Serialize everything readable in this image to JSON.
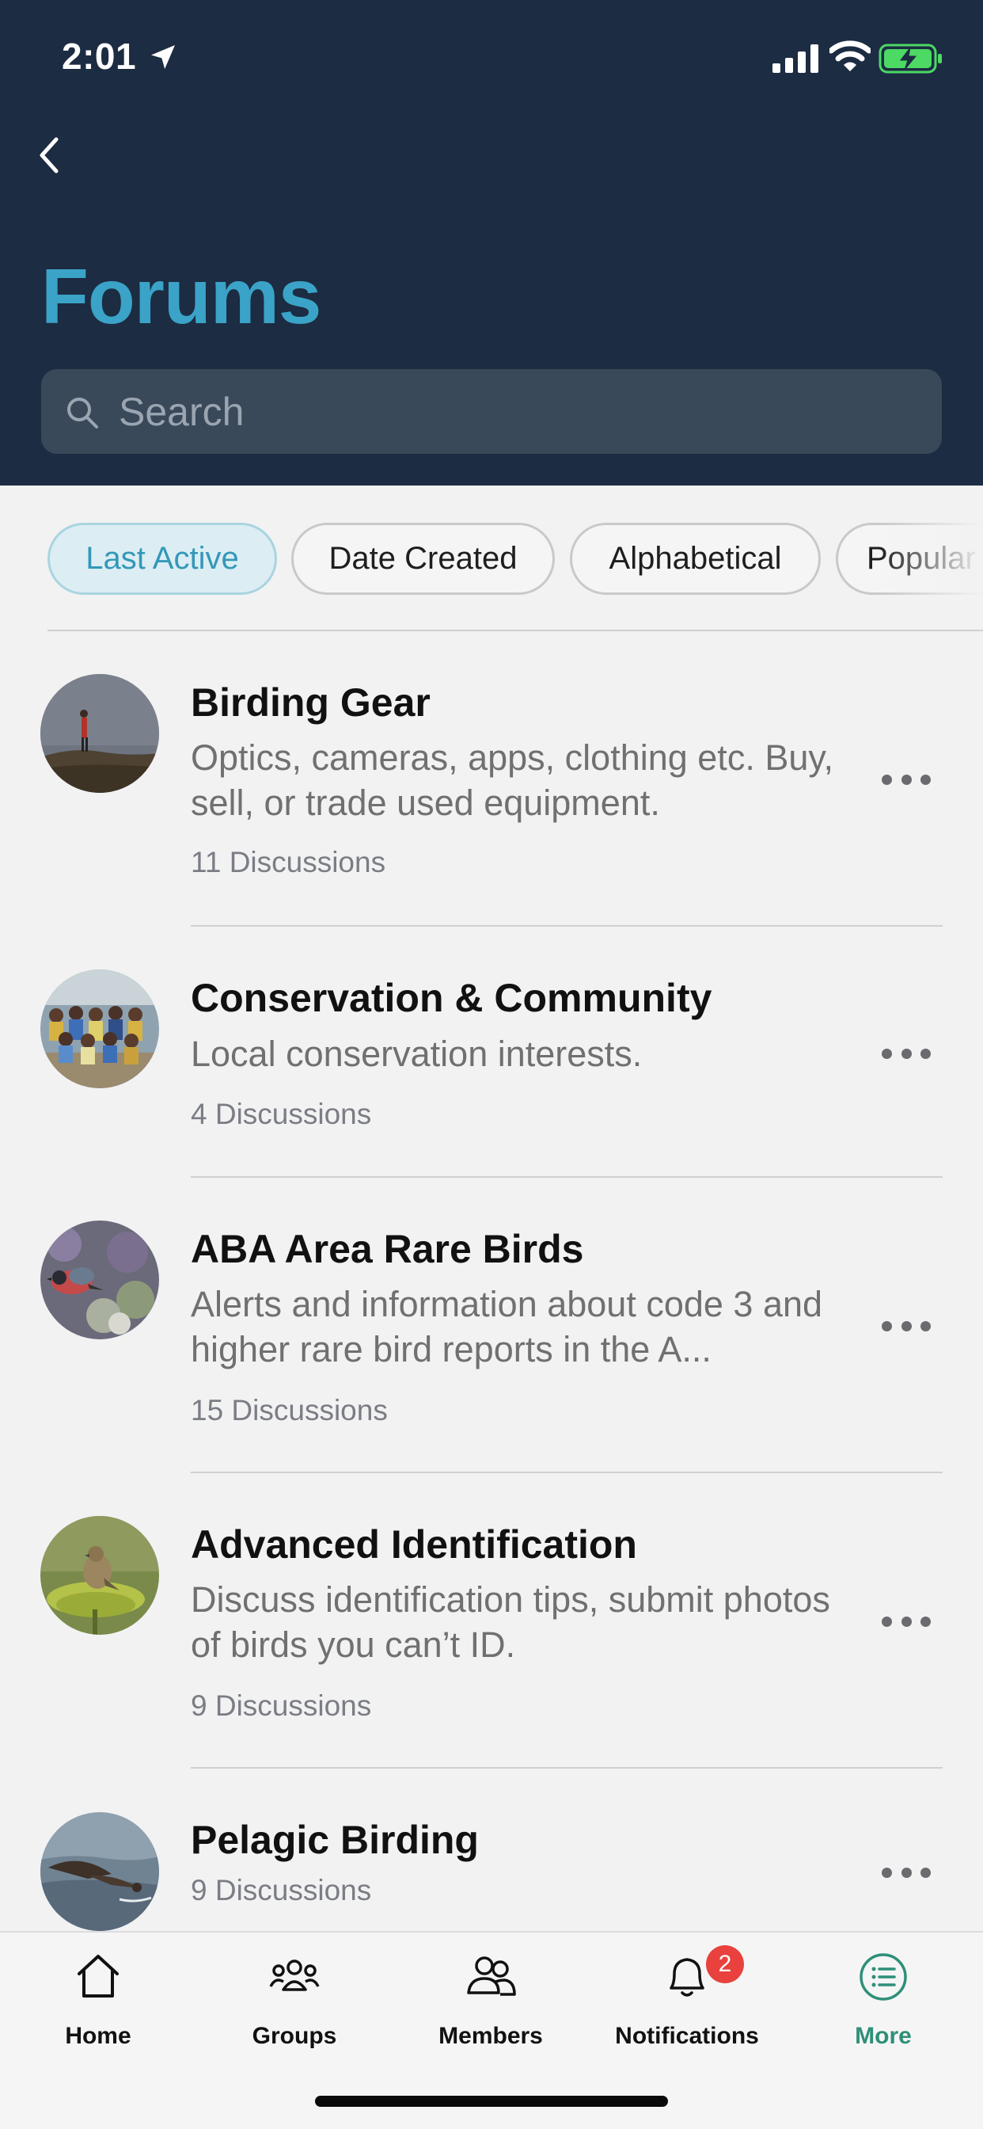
{
  "status_bar": {
    "time": "2:01",
    "icons": [
      "location-arrow-icon",
      "cellular-signal-icon",
      "wifi-icon",
      "battery-charging-icon"
    ]
  },
  "header": {
    "title": "Forums",
    "search_placeholder": "Search",
    "background_color": "#1c2c42",
    "title_color": "#3aa3c7"
  },
  "filters": [
    {
      "label": "Last Active",
      "active": true
    },
    {
      "label": "Date Created",
      "active": false
    },
    {
      "label": "Alphabetical",
      "active": false
    },
    {
      "label": "Popular",
      "active": false
    }
  ],
  "forums": [
    {
      "title": "Birding Gear",
      "description": "Optics, cameras, apps, clothing etc. Buy, sell, or trade used equipment.",
      "count": "11 Discussions"
    },
    {
      "title": "Conservation & Community",
      "description": "Local conservation interests.",
      "count": "4 Discussions"
    },
    {
      "title": "ABA Area Rare Birds",
      "description": "Alerts and information about code 3 and higher rare bird reports in the A...",
      "count": "15 Discussions"
    },
    {
      "title": "Advanced Identification",
      "description": "Discuss identification tips, submit photos of birds you can’t ID.",
      "count": "9 Discussions"
    },
    {
      "title": "Pelagic Birding",
      "description": "",
      "count": "9 Discussions"
    }
  ],
  "tabbar": {
    "items": [
      {
        "label": "Home",
        "icon": "home-icon"
      },
      {
        "label": "Groups",
        "icon": "groups-icon"
      },
      {
        "label": "Members",
        "icon": "members-icon"
      },
      {
        "label": "Notifications",
        "icon": "bell-icon",
        "badge": "2"
      },
      {
        "label": "More",
        "icon": "more-list-icon",
        "active": true
      }
    ],
    "active_color": "#2f8f78",
    "badge_color": "#e8413e"
  }
}
